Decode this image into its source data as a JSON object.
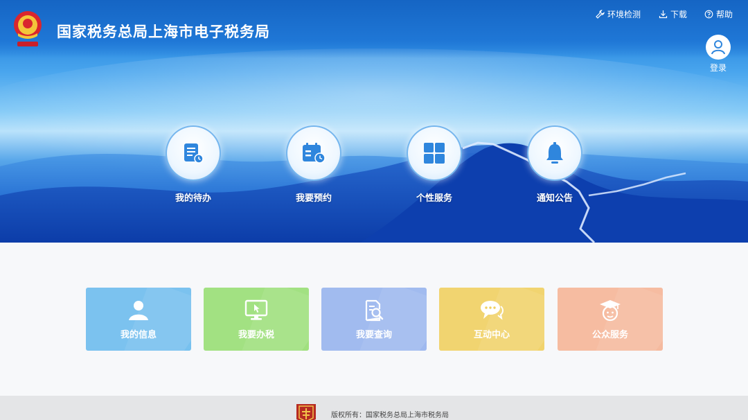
{
  "header": {
    "title": "国家税务总局上海市电子税务局",
    "logo_icon": "tax-bureau-emblem-icon",
    "links": [
      {
        "label": "环境检测",
        "icon": "wrench-icon"
      },
      {
        "label": "下载",
        "icon": "download-icon"
      },
      {
        "label": "帮助",
        "icon": "help-circle-icon"
      }
    ],
    "login": {
      "label": "登录",
      "icon": "user-icon"
    }
  },
  "hero": {
    "quick_actions": [
      {
        "label": "我的待办",
        "icon": "todo-document-icon"
      },
      {
        "label": "我要预约",
        "icon": "calendar-clock-icon"
      },
      {
        "label": "个性服务",
        "icon": "grid-icon"
      },
      {
        "label": "通知公告",
        "icon": "bell-icon"
      }
    ]
  },
  "services": [
    {
      "label": "我的信息",
      "icon": "person-icon",
      "color": "#6cbcee"
    },
    {
      "label": "我要办税",
      "icon": "monitor-cursor-icon",
      "color": "#98de74"
    },
    {
      "label": "我要查询",
      "icon": "document-search-icon",
      "color": "#97b4ee"
    },
    {
      "label": "互动中心",
      "icon": "chat-bubble-icon",
      "color": "#f0d060"
    },
    {
      "label": "公众服务",
      "icon": "graduate-icon",
      "color": "#f5b597"
    }
  ],
  "footer": {
    "copyright": "版权所有：国家税务总局上海市税务局",
    "emblem_icon": "tax-emblem-icon"
  },
  "colors": {
    "header_blue": "#1a70cc",
    "icon_blue": "#2f86dd",
    "footer_bg": "#e4e5e7"
  }
}
